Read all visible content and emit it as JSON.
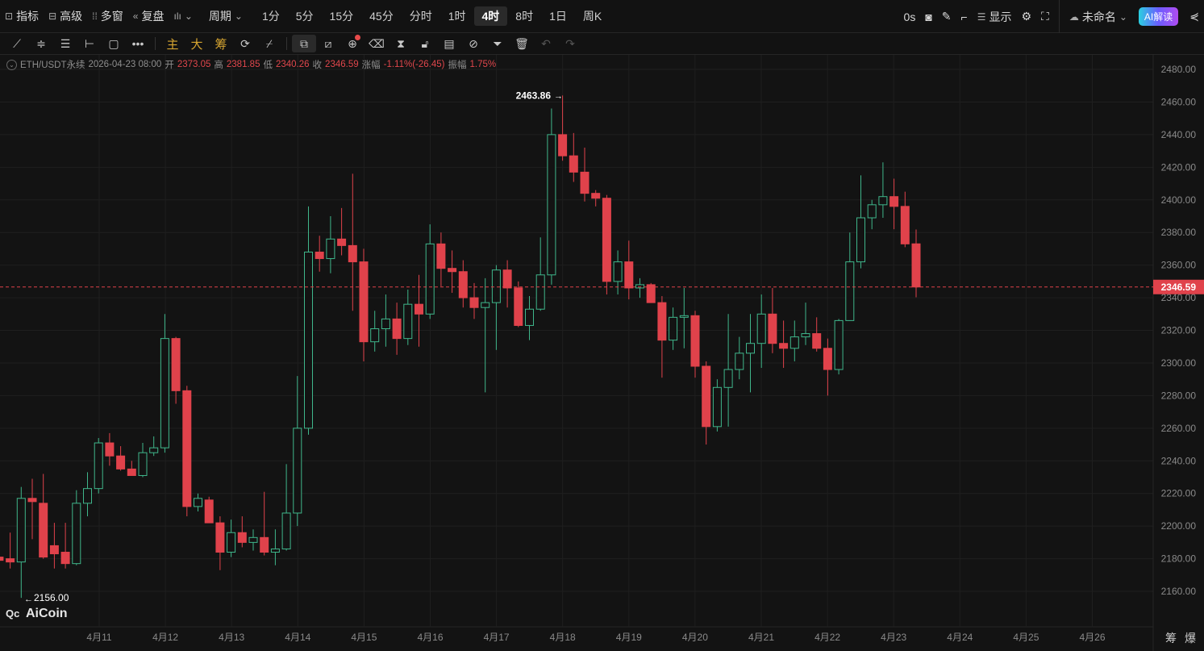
{
  "toolbar": {
    "indicators": "指标",
    "advanced": "高级",
    "multi_window": "多窗",
    "replay": "复盘",
    "period": "周期",
    "periods": [
      "1分",
      "5分",
      "15分",
      "45分",
      "分时",
      "1时",
      "4时",
      "8时",
      "1日",
      "周K"
    ],
    "active_period": "4时",
    "countdown": "0s",
    "display": "显示",
    "layout_name": "未命名",
    "ai_button": "AI解读"
  },
  "drawing_toolbar": {
    "main": "主",
    "big": "大",
    "chips": "筹"
  },
  "info": {
    "symbol": "ETH/USDT永续",
    "datetime": "2026-04-23 08:00",
    "open_label": "开",
    "open": "2373.05",
    "high_label": "高",
    "high": "2381.85",
    "low_label": "低",
    "low": "2340.26",
    "close_label": "收",
    "close": "2346.59",
    "change_label": "涨幅",
    "change": "-1.11%(-26.45)",
    "amplitude_label": "振幅",
    "amplitude": "1.75%"
  },
  "watermark": "AiCoin",
  "bottom_right": [
    "筹",
    "爆"
  ],
  "colors": {
    "up": "#3fb68b",
    "down": "#e0424b",
    "bg": "#131313"
  },
  "chart_data": {
    "type": "candlestick",
    "interval": "4h",
    "symbol": "ETH/USDT永续",
    "ylim": [
      2150,
      2490
    ],
    "y_ticks": [
      "2480.00",
      "2460.00",
      "2440.00",
      "2420.00",
      "2400.00",
      "2380.00",
      "2360.00",
      "2340.00",
      "2320.00",
      "2300.00",
      "2280.00",
      "2260.00",
      "2240.00",
      "2220.00",
      "2200.00",
      "2180.00",
      "2160.00"
    ],
    "x_labels": [
      "4月11",
      "4月12",
      "4月13",
      "4月14",
      "4月15",
      "4月16",
      "4月17",
      "4月18",
      "4月19",
      "4月20",
      "4月21",
      "4月22",
      "4月23",
      "4月24",
      "4月25",
      "4月26"
    ],
    "last_price": "2346.59",
    "max_label": "2463.86",
    "min_label": "2156.00",
    "ohlc": [
      [
        2181,
        2183,
        2177,
        2179
      ],
      [
        2180,
        2196,
        2174,
        2178
      ],
      [
        2178,
        2224,
        2156,
        2217
      ],
      [
        2217,
        2229,
        2192,
        2215
      ],
      [
        2214,
        2232,
        2180,
        2181
      ],
      [
        2188,
        2202,
        2174,
        2183
      ],
      [
        2184,
        2202,
        2174,
        2177
      ],
      [
        2177,
        2222,
        2176,
        2214
      ],
      [
        2214,
        2233,
        2206,
        2223
      ],
      [
        2223,
        2254,
        2220,
        2251
      ],
      [
        2251,
        2257,
        2237,
        2243
      ],
      [
        2243,
        2249,
        2234,
        2235
      ],
      [
        2235,
        2240,
        2231,
        2231
      ],
      [
        2231,
        2251,
        2230,
        2245
      ],
      [
        2245,
        2255,
        2243,
        2248
      ],
      [
        2248,
        2330,
        2245,
        2315
      ],
      [
        2315,
        2316,
        2275,
        2283
      ],
      [
        2283,
        2286,
        2206,
        2212
      ],
      [
        2212,
        2220,
        2209,
        2217
      ],
      [
        2216,
        2218,
        2202,
        2202
      ],
      [
        2202,
        2206,
        2173,
        2184
      ],
      [
        2184,
        2204,
        2181,
        2196
      ],
      [
        2196,
        2206,
        2187,
        2190
      ],
      [
        2190,
        2198,
        2185,
        2193
      ],
      [
        2193,
        2221,
        2182,
        2184
      ],
      [
        2184,
        2198,
        2176,
        2186
      ],
      [
        2186,
        2238,
        2185,
        2208
      ],
      [
        2208,
        2292,
        2200,
        2260
      ],
      [
        2260,
        2396,
        2256,
        2368
      ],
      [
        2368,
        2378,
        2356,
        2364
      ],
      [
        2364,
        2390,
        2355,
        2376
      ],
      [
        2376,
        2395,
        2366,
        2372
      ],
      [
        2372,
        2416,
        2332,
        2362
      ],
      [
        2362,
        2370,
        2301,
        2313
      ],
      [
        2313,
        2332,
        2307,
        2321
      ],
      [
        2321,
        2342,
        2310,
        2327
      ],
      [
        2327,
        2337,
        2305,
        2315
      ],
      [
        2315,
        2345,
        2311,
        2336
      ],
      [
        2336,
        2354,
        2310,
        2330
      ],
      [
        2330,
        2385,
        2327,
        2373
      ],
      [
        2373,
        2380,
        2347,
        2358
      ],
      [
        2358,
        2369,
        2343,
        2356
      ],
      [
        2356,
        2363,
        2334,
        2340
      ],
      [
        2340,
        2349,
        2327,
        2334
      ],
      [
        2334,
        2352,
        2282,
        2337
      ],
      [
        2337,
        2360,
        2308,
        2357
      ],
      [
        2357,
        2363,
        2334,
        2346
      ],
      [
        2346,
        2350,
        2322,
        2323
      ],
      [
        2323,
        2341,
        2314,
        2333
      ],
      [
        2333,
        2377,
        2332,
        2354
      ],
      [
        2354,
        2456,
        2348,
        2440
      ],
      [
        2440,
        2464,
        2424,
        2427
      ],
      [
        2427,
        2441,
        2411,
        2417
      ],
      [
        2417,
        2432,
        2399,
        2404
      ],
      [
        2404,
        2406,
        2396,
        2401
      ],
      [
        2401,
        2403,
        2342,
        2350
      ],
      [
        2350,
        2369,
        2342,
        2362
      ],
      [
        2362,
        2375,
        2339,
        2346
      ],
      [
        2346,
        2352,
        2340,
        2348
      ],
      [
        2348,
        2349,
        2338,
        2337
      ],
      [
        2337,
        2341,
        2291,
        2314
      ],
      [
        2314,
        2334,
        2308,
        2328
      ],
      [
        2328,
        2346,
        2309,
        2329
      ],
      [
        2329,
        2332,
        2291,
        2298
      ],
      [
        2298,
        2301,
        2250,
        2261
      ],
      [
        2261,
        2290,
        2258,
        2285
      ],
      [
        2285,
        2330,
        2261,
        2296
      ],
      [
        2296,
        2316,
        2290,
        2306
      ],
      [
        2306,
        2330,
        2282,
        2312
      ],
      [
        2312,
        2342,
        2297,
        2330
      ],
      [
        2330,
        2346,
        2306,
        2312
      ],
      [
        2312,
        2326,
        2297,
        2309
      ],
      [
        2309,
        2326,
        2301,
        2316
      ],
      [
        2316,
        2337,
        2311,
        2318
      ],
      [
        2318,
        2328,
        2307,
        2309
      ],
      [
        2309,
        2315,
        2280,
        2296
      ],
      [
        2296,
        2327,
        2293,
        2326
      ],
      [
        2326,
        2380,
        2326,
        2362
      ],
      [
        2362,
        2415,
        2358,
        2389
      ],
      [
        2389,
        2400,
        2382,
        2397
      ],
      [
        2397,
        2423,
        2389,
        2402
      ],
      [
        2402,
        2413,
        2382,
        2396
      ],
      [
        2396,
        2405,
        2371,
        2373
      ],
      [
        2373.05,
        2381.85,
        2340.26,
        2346.59
      ]
    ]
  }
}
